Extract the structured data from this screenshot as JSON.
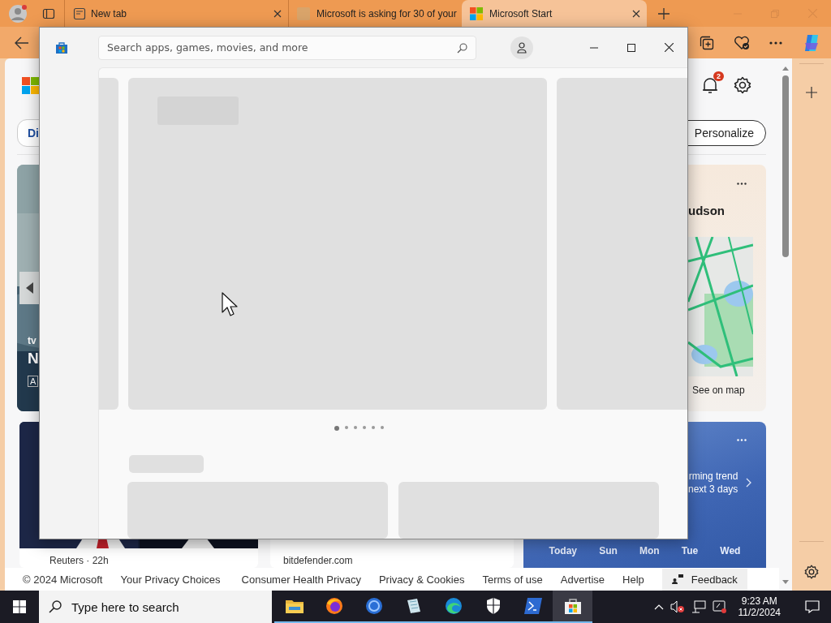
{
  "browser": {
    "tabs": [
      {
        "title": "New tab",
        "kind": "newtab",
        "selected": false
      },
      {
        "title": "Microsoft is asking for 30 of your",
        "kind": "article",
        "selected": false
      },
      {
        "title": "Microsoft Start",
        "kind": "start",
        "selected": true
      }
    ]
  },
  "page": {
    "nav_chip": "Di",
    "notification_count": "2",
    "personalize": "Personalize",
    "lead_card": {
      "label": "tv",
      "headline": "N",
      "tag": "A"
    },
    "map_card": {
      "title": "udson",
      "link": "See on map"
    },
    "news_cards": [
      {
        "source": "Reuters · 22h"
      },
      {
        "kind": "text",
        "source": "bitdefender.com"
      }
    ],
    "weather_card": {
      "message_lines": [
        "rming trend",
        "next 3 days"
      ],
      "days": [
        "Today",
        "Sun",
        "Mon",
        "Tue",
        "Wed"
      ]
    },
    "footer": {
      "copyright": "© 2024 Microsoft",
      "links": [
        "Your Privacy Choices",
        "Consumer Health Privacy",
        "Privacy & Cookies",
        "Terms of use",
        "Advertise",
        "Help"
      ],
      "feedback": "Feedback"
    }
  },
  "store_window": {
    "search": {
      "placeholder": "Search apps, games, movies, and more"
    },
    "carousel_dots": [
      {
        "selected": true
      },
      {
        "selected": false
      },
      {
        "selected": false
      },
      {
        "selected": false
      },
      {
        "selected": false
      },
      {
        "selected": false
      }
    ]
  },
  "taskbar": {
    "search_placeholder": "Type here to search",
    "apps": [
      {
        "kind": "folder",
        "running": true,
        "selected": false
      },
      {
        "kind": "firefox",
        "running": true,
        "selected": false
      },
      {
        "kind": "circle",
        "running": true,
        "selected": false
      },
      {
        "kind": "notepad",
        "running": true,
        "selected": false
      },
      {
        "kind": "edge",
        "running": true,
        "selected": false
      },
      {
        "kind": "shield",
        "running": true,
        "selected": false
      },
      {
        "kind": "terminal",
        "running": true,
        "selected": false
      },
      {
        "kind": "store",
        "running": true,
        "selected": true
      }
    ],
    "time": "9:23 AM",
    "date": "11/2/2024"
  }
}
